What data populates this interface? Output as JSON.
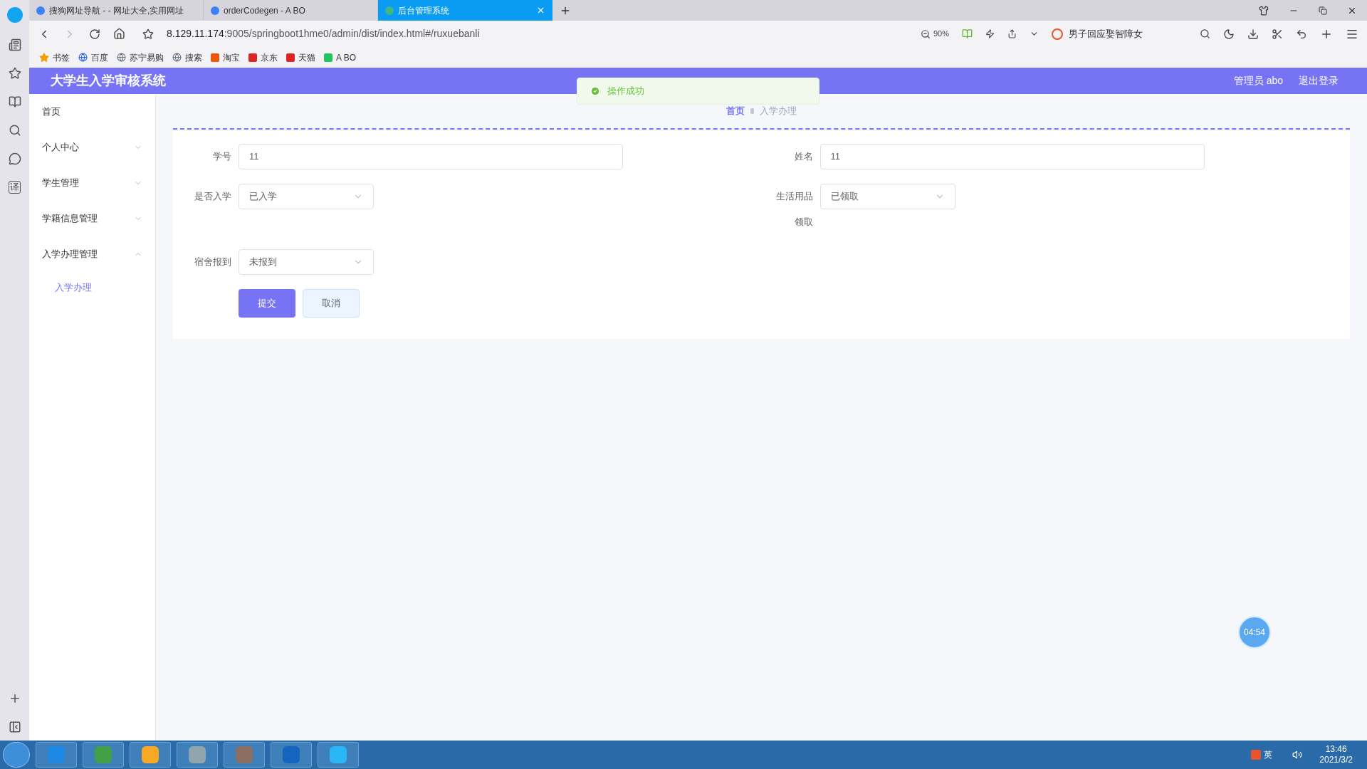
{
  "browser": {
    "tabs": [
      {
        "title": "搜狗网址导航 - - 网址大全,实用网址",
        "selected": false
      },
      {
        "title": "orderCodegen - A BO",
        "selected": false
      },
      {
        "title": "后台管理系统",
        "selected": true
      }
    ],
    "address_host": "8.129.11.174",
    "address_rest": ":9005/springboot1hme0/admin/dist/index.html#/ruxuebanli",
    "zoom": "90%",
    "search": "男子回应娶智障女",
    "rail_glyph": "译",
    "bookmarks": [
      "书签",
      "百度",
      "苏宁易购",
      "搜索",
      "淘宝",
      "京东",
      "天猫",
      "A BO"
    ]
  },
  "app": {
    "title": "大学生入学审核系统",
    "user": "管理员 abo",
    "logout": "退出登录"
  },
  "sidebar": {
    "items": [
      {
        "label": "首页"
      },
      {
        "label": "个人中心",
        "expanded": false
      },
      {
        "label": "学生管理",
        "expanded": false
      },
      {
        "label": "学籍信息管理",
        "expanded": false
      },
      {
        "label": "入学办理管理",
        "expanded": true,
        "children": [
          {
            "label": "入学办理",
            "selected": true
          }
        ]
      }
    ]
  },
  "breadcrumb": [
    "首页",
    "入学办理"
  ],
  "form": {
    "fields": [
      {
        "label": "学号",
        "kind": "text",
        "value": "11"
      },
      {
        "label": "姓名",
        "kind": "text",
        "value": "11"
      },
      {
        "label": "是否入学",
        "kind": "select",
        "value": "已入学"
      },
      {
        "label": "生活用品领取",
        "kind": "select",
        "value": "已领取"
      },
      {
        "label": "宿舍报到",
        "kind": "select",
        "value": "未报到"
      }
    ],
    "buttons": [
      {
        "label": "提交",
        "kind": "primary"
      },
      {
        "label": "取消",
        "kind": "plain"
      }
    ]
  },
  "toast": {
    "message": "操作成功"
  },
  "timer": "04:54",
  "taskbar": {
    "ime": "英",
    "time": "13:46",
    "date": "2021/3/2"
  }
}
